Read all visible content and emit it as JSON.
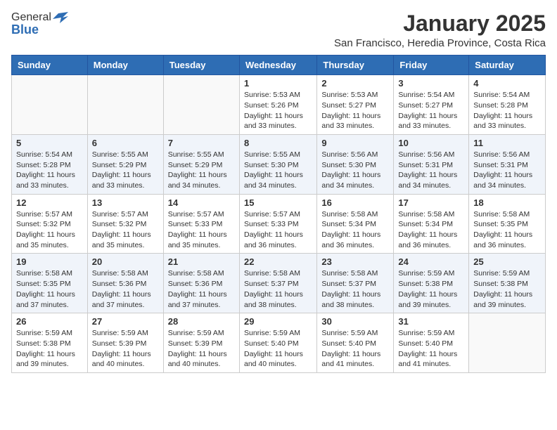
{
  "header": {
    "logo_general": "General",
    "logo_blue": "Blue",
    "title": "January 2025",
    "subtitle": "San Francisco, Heredia Province, Costa Rica"
  },
  "weekdays": [
    "Sunday",
    "Monday",
    "Tuesday",
    "Wednesday",
    "Thursday",
    "Friday",
    "Saturday"
  ],
  "weeks": [
    [
      {
        "date": "",
        "info": ""
      },
      {
        "date": "",
        "info": ""
      },
      {
        "date": "",
        "info": ""
      },
      {
        "date": "1",
        "info": "Sunrise: 5:53 AM\nSunset: 5:26 PM\nDaylight: 11 hours and 33 minutes."
      },
      {
        "date": "2",
        "info": "Sunrise: 5:53 AM\nSunset: 5:27 PM\nDaylight: 11 hours and 33 minutes."
      },
      {
        "date": "3",
        "info": "Sunrise: 5:54 AM\nSunset: 5:27 PM\nDaylight: 11 hours and 33 minutes."
      },
      {
        "date": "4",
        "info": "Sunrise: 5:54 AM\nSunset: 5:28 PM\nDaylight: 11 hours and 33 minutes."
      }
    ],
    [
      {
        "date": "5",
        "info": "Sunrise: 5:54 AM\nSunset: 5:28 PM\nDaylight: 11 hours and 33 minutes."
      },
      {
        "date": "6",
        "info": "Sunrise: 5:55 AM\nSunset: 5:29 PM\nDaylight: 11 hours and 33 minutes."
      },
      {
        "date": "7",
        "info": "Sunrise: 5:55 AM\nSunset: 5:29 PM\nDaylight: 11 hours and 34 minutes."
      },
      {
        "date": "8",
        "info": "Sunrise: 5:55 AM\nSunset: 5:30 PM\nDaylight: 11 hours and 34 minutes."
      },
      {
        "date": "9",
        "info": "Sunrise: 5:56 AM\nSunset: 5:30 PM\nDaylight: 11 hours and 34 minutes."
      },
      {
        "date": "10",
        "info": "Sunrise: 5:56 AM\nSunset: 5:31 PM\nDaylight: 11 hours and 34 minutes."
      },
      {
        "date": "11",
        "info": "Sunrise: 5:56 AM\nSunset: 5:31 PM\nDaylight: 11 hours and 34 minutes."
      }
    ],
    [
      {
        "date": "12",
        "info": "Sunrise: 5:57 AM\nSunset: 5:32 PM\nDaylight: 11 hours and 35 minutes."
      },
      {
        "date": "13",
        "info": "Sunrise: 5:57 AM\nSunset: 5:32 PM\nDaylight: 11 hours and 35 minutes."
      },
      {
        "date": "14",
        "info": "Sunrise: 5:57 AM\nSunset: 5:33 PM\nDaylight: 11 hours and 35 minutes."
      },
      {
        "date": "15",
        "info": "Sunrise: 5:57 AM\nSunset: 5:33 PM\nDaylight: 11 hours and 36 minutes."
      },
      {
        "date": "16",
        "info": "Sunrise: 5:58 AM\nSunset: 5:34 PM\nDaylight: 11 hours and 36 minutes."
      },
      {
        "date": "17",
        "info": "Sunrise: 5:58 AM\nSunset: 5:34 PM\nDaylight: 11 hours and 36 minutes."
      },
      {
        "date": "18",
        "info": "Sunrise: 5:58 AM\nSunset: 5:35 PM\nDaylight: 11 hours and 36 minutes."
      }
    ],
    [
      {
        "date": "19",
        "info": "Sunrise: 5:58 AM\nSunset: 5:35 PM\nDaylight: 11 hours and 37 minutes."
      },
      {
        "date": "20",
        "info": "Sunrise: 5:58 AM\nSunset: 5:36 PM\nDaylight: 11 hours and 37 minutes."
      },
      {
        "date": "21",
        "info": "Sunrise: 5:58 AM\nSunset: 5:36 PM\nDaylight: 11 hours and 37 minutes."
      },
      {
        "date": "22",
        "info": "Sunrise: 5:58 AM\nSunset: 5:37 PM\nDaylight: 11 hours and 38 minutes."
      },
      {
        "date": "23",
        "info": "Sunrise: 5:58 AM\nSunset: 5:37 PM\nDaylight: 11 hours and 38 minutes."
      },
      {
        "date": "24",
        "info": "Sunrise: 5:59 AM\nSunset: 5:38 PM\nDaylight: 11 hours and 39 minutes."
      },
      {
        "date": "25",
        "info": "Sunrise: 5:59 AM\nSunset: 5:38 PM\nDaylight: 11 hours and 39 minutes."
      }
    ],
    [
      {
        "date": "26",
        "info": "Sunrise: 5:59 AM\nSunset: 5:38 PM\nDaylight: 11 hours and 39 minutes."
      },
      {
        "date": "27",
        "info": "Sunrise: 5:59 AM\nSunset: 5:39 PM\nDaylight: 11 hours and 40 minutes."
      },
      {
        "date": "28",
        "info": "Sunrise: 5:59 AM\nSunset: 5:39 PM\nDaylight: 11 hours and 40 minutes."
      },
      {
        "date": "29",
        "info": "Sunrise: 5:59 AM\nSunset: 5:40 PM\nDaylight: 11 hours and 40 minutes."
      },
      {
        "date": "30",
        "info": "Sunrise: 5:59 AM\nSunset: 5:40 PM\nDaylight: 11 hours and 41 minutes."
      },
      {
        "date": "31",
        "info": "Sunrise: 5:59 AM\nSunset: 5:40 PM\nDaylight: 11 hours and 41 minutes."
      },
      {
        "date": "",
        "info": ""
      }
    ]
  ]
}
